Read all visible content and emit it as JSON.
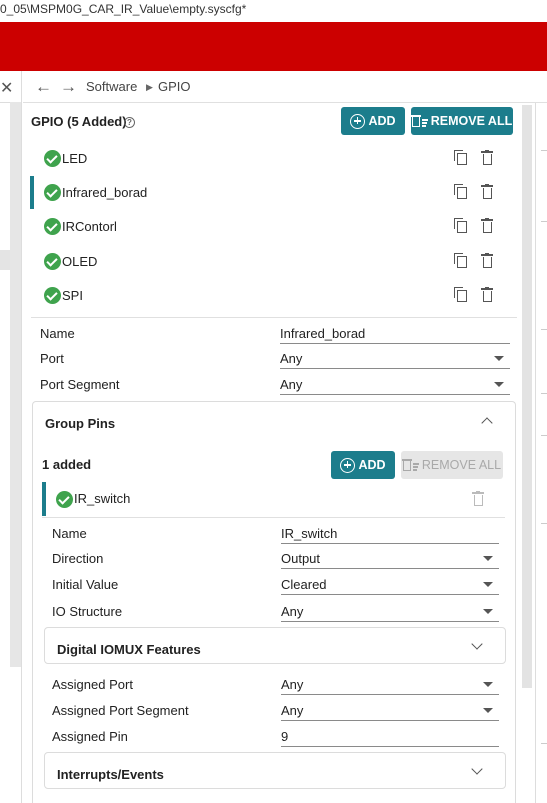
{
  "window": {
    "title": "0_05\\MSPM0G_CAR_IR_Value\\empty.syscfg*"
  },
  "breadcrumb": {
    "items": [
      "Software",
      "GPIO"
    ]
  },
  "gpio": {
    "header": "GPIO (5 Added)",
    "help_icon": "?",
    "add_label": "ADD",
    "remove_all_label": "REMOVE ALL",
    "items": [
      {
        "label": "LED",
        "selected": false
      },
      {
        "label": "Infrared_borad",
        "selected": true
      },
      {
        "label": "IRContorl",
        "selected": false
      },
      {
        "label": "OLED",
        "selected": false
      },
      {
        "label": "SPI",
        "selected": false
      }
    ]
  },
  "properties": {
    "name_label": "Name",
    "name_value": "Infrared_borad",
    "port_label": "Port",
    "port_value": "Any",
    "port_segment_label": "Port Segment",
    "port_segment_value": "Any"
  },
  "group_pins": {
    "title": "Group Pins",
    "count_label": "1 added",
    "add_label": "ADD",
    "remove_all_label": "REMOVE ALL",
    "pin": {
      "label": "IR_switch"
    },
    "fields": {
      "name_label": "Name",
      "name_value": "IR_switch",
      "direction_label": "Direction",
      "direction_value": "Output",
      "initial_value_label": "Initial Value",
      "initial_value_value": "Cleared",
      "io_structure_label": "IO Structure",
      "io_structure_value": "Any"
    },
    "digital_iomux": {
      "title": "Digital IOMUX Features"
    },
    "assigned": {
      "port_label": "Assigned Port",
      "port_value": "Any",
      "segment_label": "Assigned Port Segment",
      "segment_value": "Any",
      "pin_label": "Assigned Pin",
      "pin_value": "9"
    },
    "interrupts": {
      "title": "Interrupts/Events"
    }
  },
  "colors": {
    "brand_red": "#cc0000",
    "accent_teal": "#1c7d8c",
    "check_green": "#3fa34d"
  },
  "icons": [
    "close-icon",
    "back-arrow-icon",
    "forward-arrow-icon",
    "chevron-right-icon",
    "help-icon",
    "add-circle-icon",
    "remove-all-icon",
    "check-circle-icon",
    "copy-icon",
    "trash-icon",
    "chevron-up-icon",
    "chevron-down-icon",
    "dropdown-caret-icon"
  ]
}
